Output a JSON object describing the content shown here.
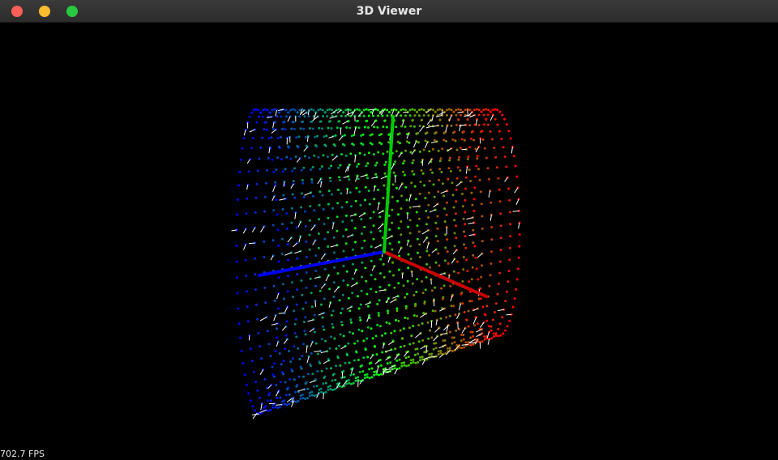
{
  "window": {
    "title": "3D Viewer",
    "controls": {
      "close_color": "#ff5f57",
      "minimize_color": "#febc2e",
      "maximize_color": "#28c840"
    }
  },
  "viewport": {
    "background": "#000000",
    "axes": {
      "x_color": "#cc0000",
      "y_color": "#00cc00",
      "z_color": "#0000ee"
    },
    "point_cloud": {
      "shape": "cylinder",
      "color_gradient": [
        "#0000ff",
        "#00ff00",
        "#ff0000"
      ],
      "normals_color": "#ffffff"
    }
  },
  "status": {
    "fps_text": "702.7 FPS"
  }
}
